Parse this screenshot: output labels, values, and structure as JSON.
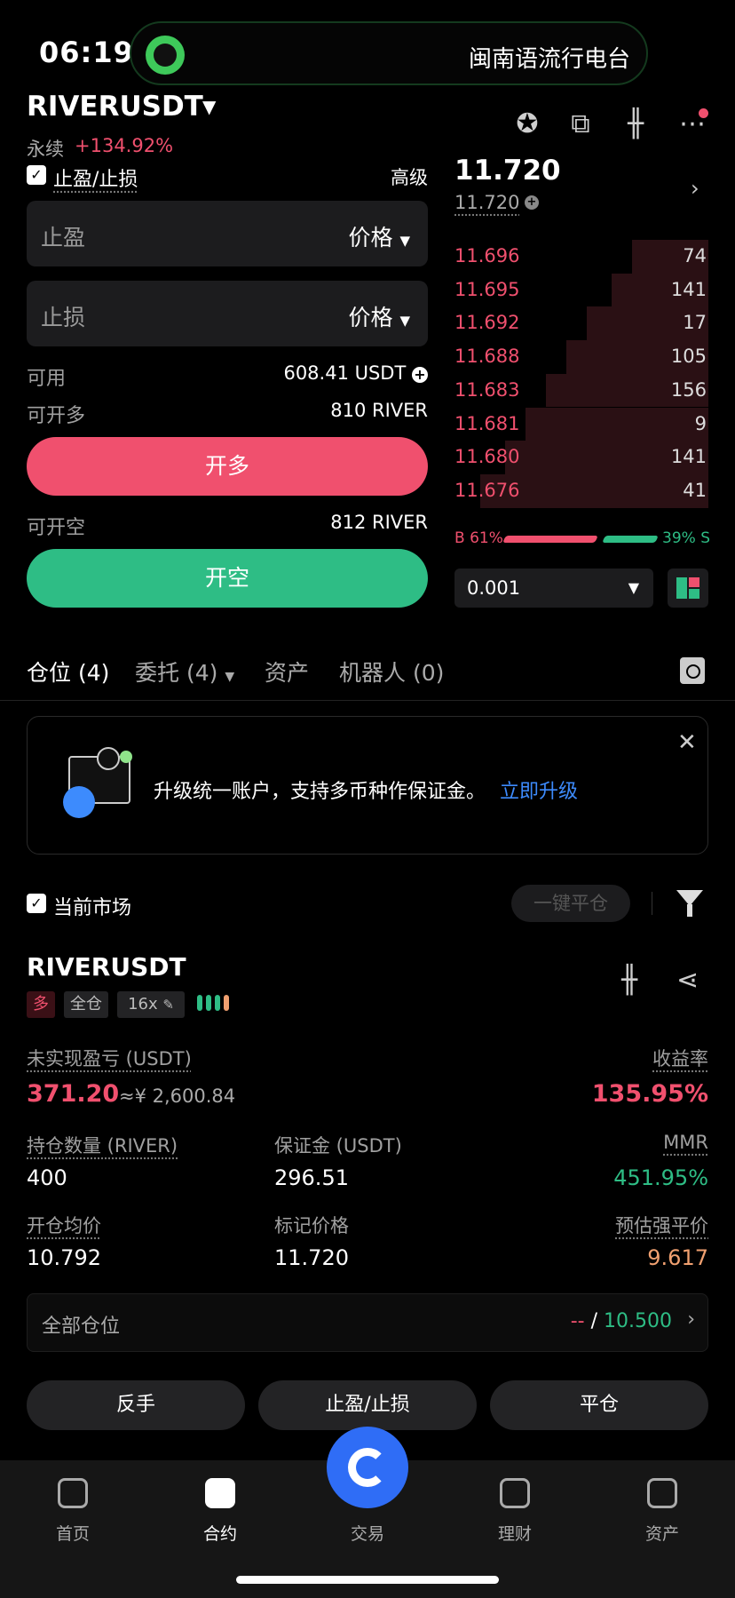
{
  "status_bar": {
    "time": "06:19",
    "island_text": "闽南语流行电台"
  },
  "header": {
    "pair": "RIVERUSDT",
    "perp_label": "永续",
    "change": "+134.92%",
    "icons": [
      "medal-icon",
      "chart-settings-icon",
      "candlestick-icon",
      "more-icon"
    ]
  },
  "order_form": {
    "tpsl_label": "止盈/止损",
    "advanced_label": "高级",
    "take_profit": {
      "label": "止盈",
      "type": "价格"
    },
    "stop_loss": {
      "label": "止损",
      "type": "价格"
    },
    "available_label": "可用",
    "available_value": "608.41 USDT",
    "can_long_label": "可开多",
    "can_long_value": "810 RIVER",
    "long_button": "开多",
    "can_short_label": "可开空",
    "can_short_value": "812 RIVER",
    "short_button": "开空"
  },
  "order_book": {
    "last_price": "11.720",
    "mark_price": "11.720",
    "asks": [
      {
        "price": "11.696",
        "qty": "74",
        "depth": 0.3
      },
      {
        "price": "11.695",
        "qty": "141",
        "depth": 0.38
      },
      {
        "price": "11.692",
        "qty": "17",
        "depth": 0.48
      },
      {
        "price": "11.688",
        "qty": "105",
        "depth": 0.56
      },
      {
        "price": "11.683",
        "qty": "156",
        "depth": 0.64
      },
      {
        "price": "11.681",
        "qty": "9",
        "depth": 0.72
      },
      {
        "price": "11.680",
        "qty": "141",
        "depth": 0.8
      },
      {
        "price": "11.676",
        "qty": "41",
        "depth": 0.9
      }
    ],
    "buy_ratio": "B 61%",
    "sell_ratio": "39% S",
    "step": "0.001"
  },
  "tabs": {
    "positions": "仓位 (4)",
    "orders": "委托 (4)",
    "assets": "资产",
    "bots": "机器人 (0)"
  },
  "banner": {
    "text": "升级统一账户，支持多币种作保证金。",
    "link": "立即升级"
  },
  "filter": {
    "current_market": "当前市场",
    "close_all": "一键平仓"
  },
  "position": {
    "symbol": "RIVERUSDT",
    "side": "多",
    "margin_mode": "全仓",
    "leverage": "16x",
    "upnl_label": "未实现盈亏 (USDT)",
    "upnl_value": "371.20",
    "upnl_cny": "≈¥ 2,600.84",
    "roe_label": "收益率",
    "roe_value": "135.95%",
    "qty_label": "持仓数量 (RIVER)",
    "qty_value": "400",
    "margin_label": "保证金 (USDT)",
    "margin_value": "296.51",
    "mmr_label": "MMR",
    "mmr_value": "451.95%",
    "entry_label": "开仓均价",
    "entry_value": "10.792",
    "mark_label": "标记价格",
    "mark_value": "11.720",
    "liq_label": "预估强平价",
    "liq_value": "9.617"
  },
  "all_positions": {
    "label": "全部仓位",
    "dash": "--",
    "sep": " / ",
    "value": "10.500"
  },
  "actions": {
    "reverse": "反手",
    "tpsl": "止盈/止损",
    "close": "平仓"
  },
  "nav": {
    "home": "首页",
    "futures": "合约",
    "trade": "交易",
    "earn": "理财",
    "assets": "资产"
  }
}
